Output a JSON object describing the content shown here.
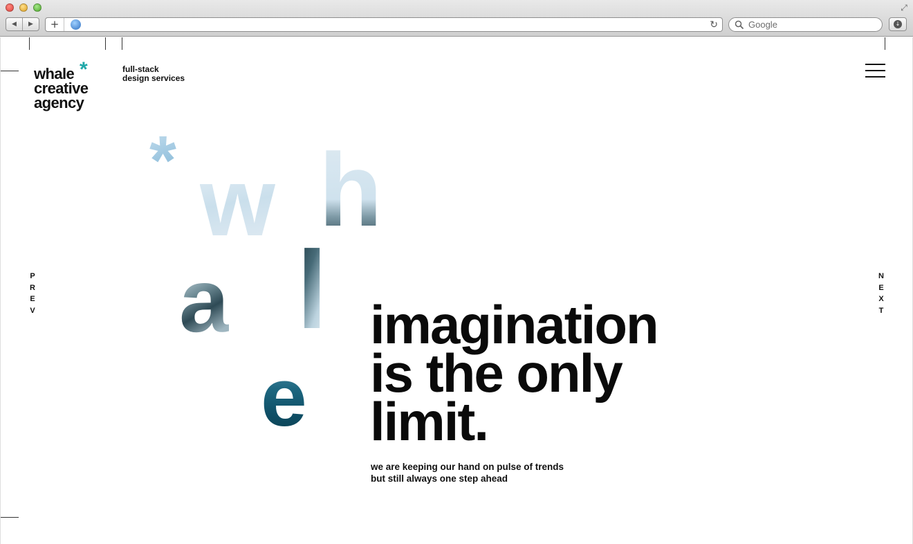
{
  "browser": {
    "search_placeholder": "Google",
    "nav_back_icon": "◀",
    "nav_forward_icon": "▶",
    "new_tab_icon": "+",
    "reload_icon": "↻"
  },
  "site": {
    "logo": {
      "line1": "whale",
      "line2": "creative",
      "line3": "agency",
      "asterisk": "*",
      "accent_color": "#1ea7a8"
    },
    "tagline": {
      "line1": "full-stack",
      "line2": "design services"
    },
    "nav": {
      "prev_letters": [
        "P",
        "R",
        "E",
        "V"
      ],
      "next_letters": [
        "N",
        "E",
        "X",
        "T"
      ]
    },
    "hero_letters": {
      "asterisk": "*",
      "w": "w",
      "h": "h",
      "a": "a",
      "l": "l",
      "e": "e"
    },
    "headline": {
      "line1": "imagination",
      "line2": "is the only",
      "line3": "limit."
    },
    "subline": {
      "line1": "we are keeping our hand on pulse of trends",
      "line2": "but still always one step ahead"
    }
  }
}
